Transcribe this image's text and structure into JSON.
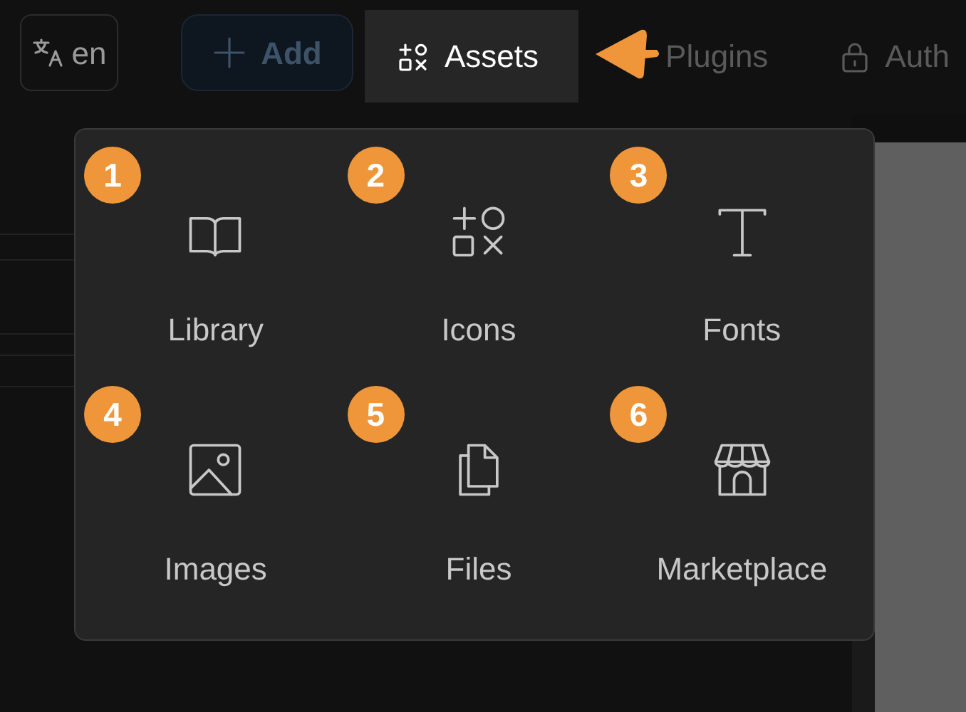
{
  "toolbar": {
    "language_button": {
      "label": "en"
    },
    "add_button": {
      "label": "Add"
    },
    "nav_items": [
      {
        "label": "Assets",
        "selected": true
      },
      {
        "label": "Plugins",
        "selected": false
      },
      {
        "label": "Auth",
        "selected": false
      }
    ]
  },
  "assets_menu": {
    "items": [
      {
        "number": "1",
        "label": "Library"
      },
      {
        "number": "2",
        "label": "Icons"
      },
      {
        "number": "3",
        "label": "Fonts"
      },
      {
        "number": "4",
        "label": "Images"
      },
      {
        "number": "5",
        "label": "Files"
      },
      {
        "number": "6",
        "label": "Marketplace"
      }
    ]
  }
}
